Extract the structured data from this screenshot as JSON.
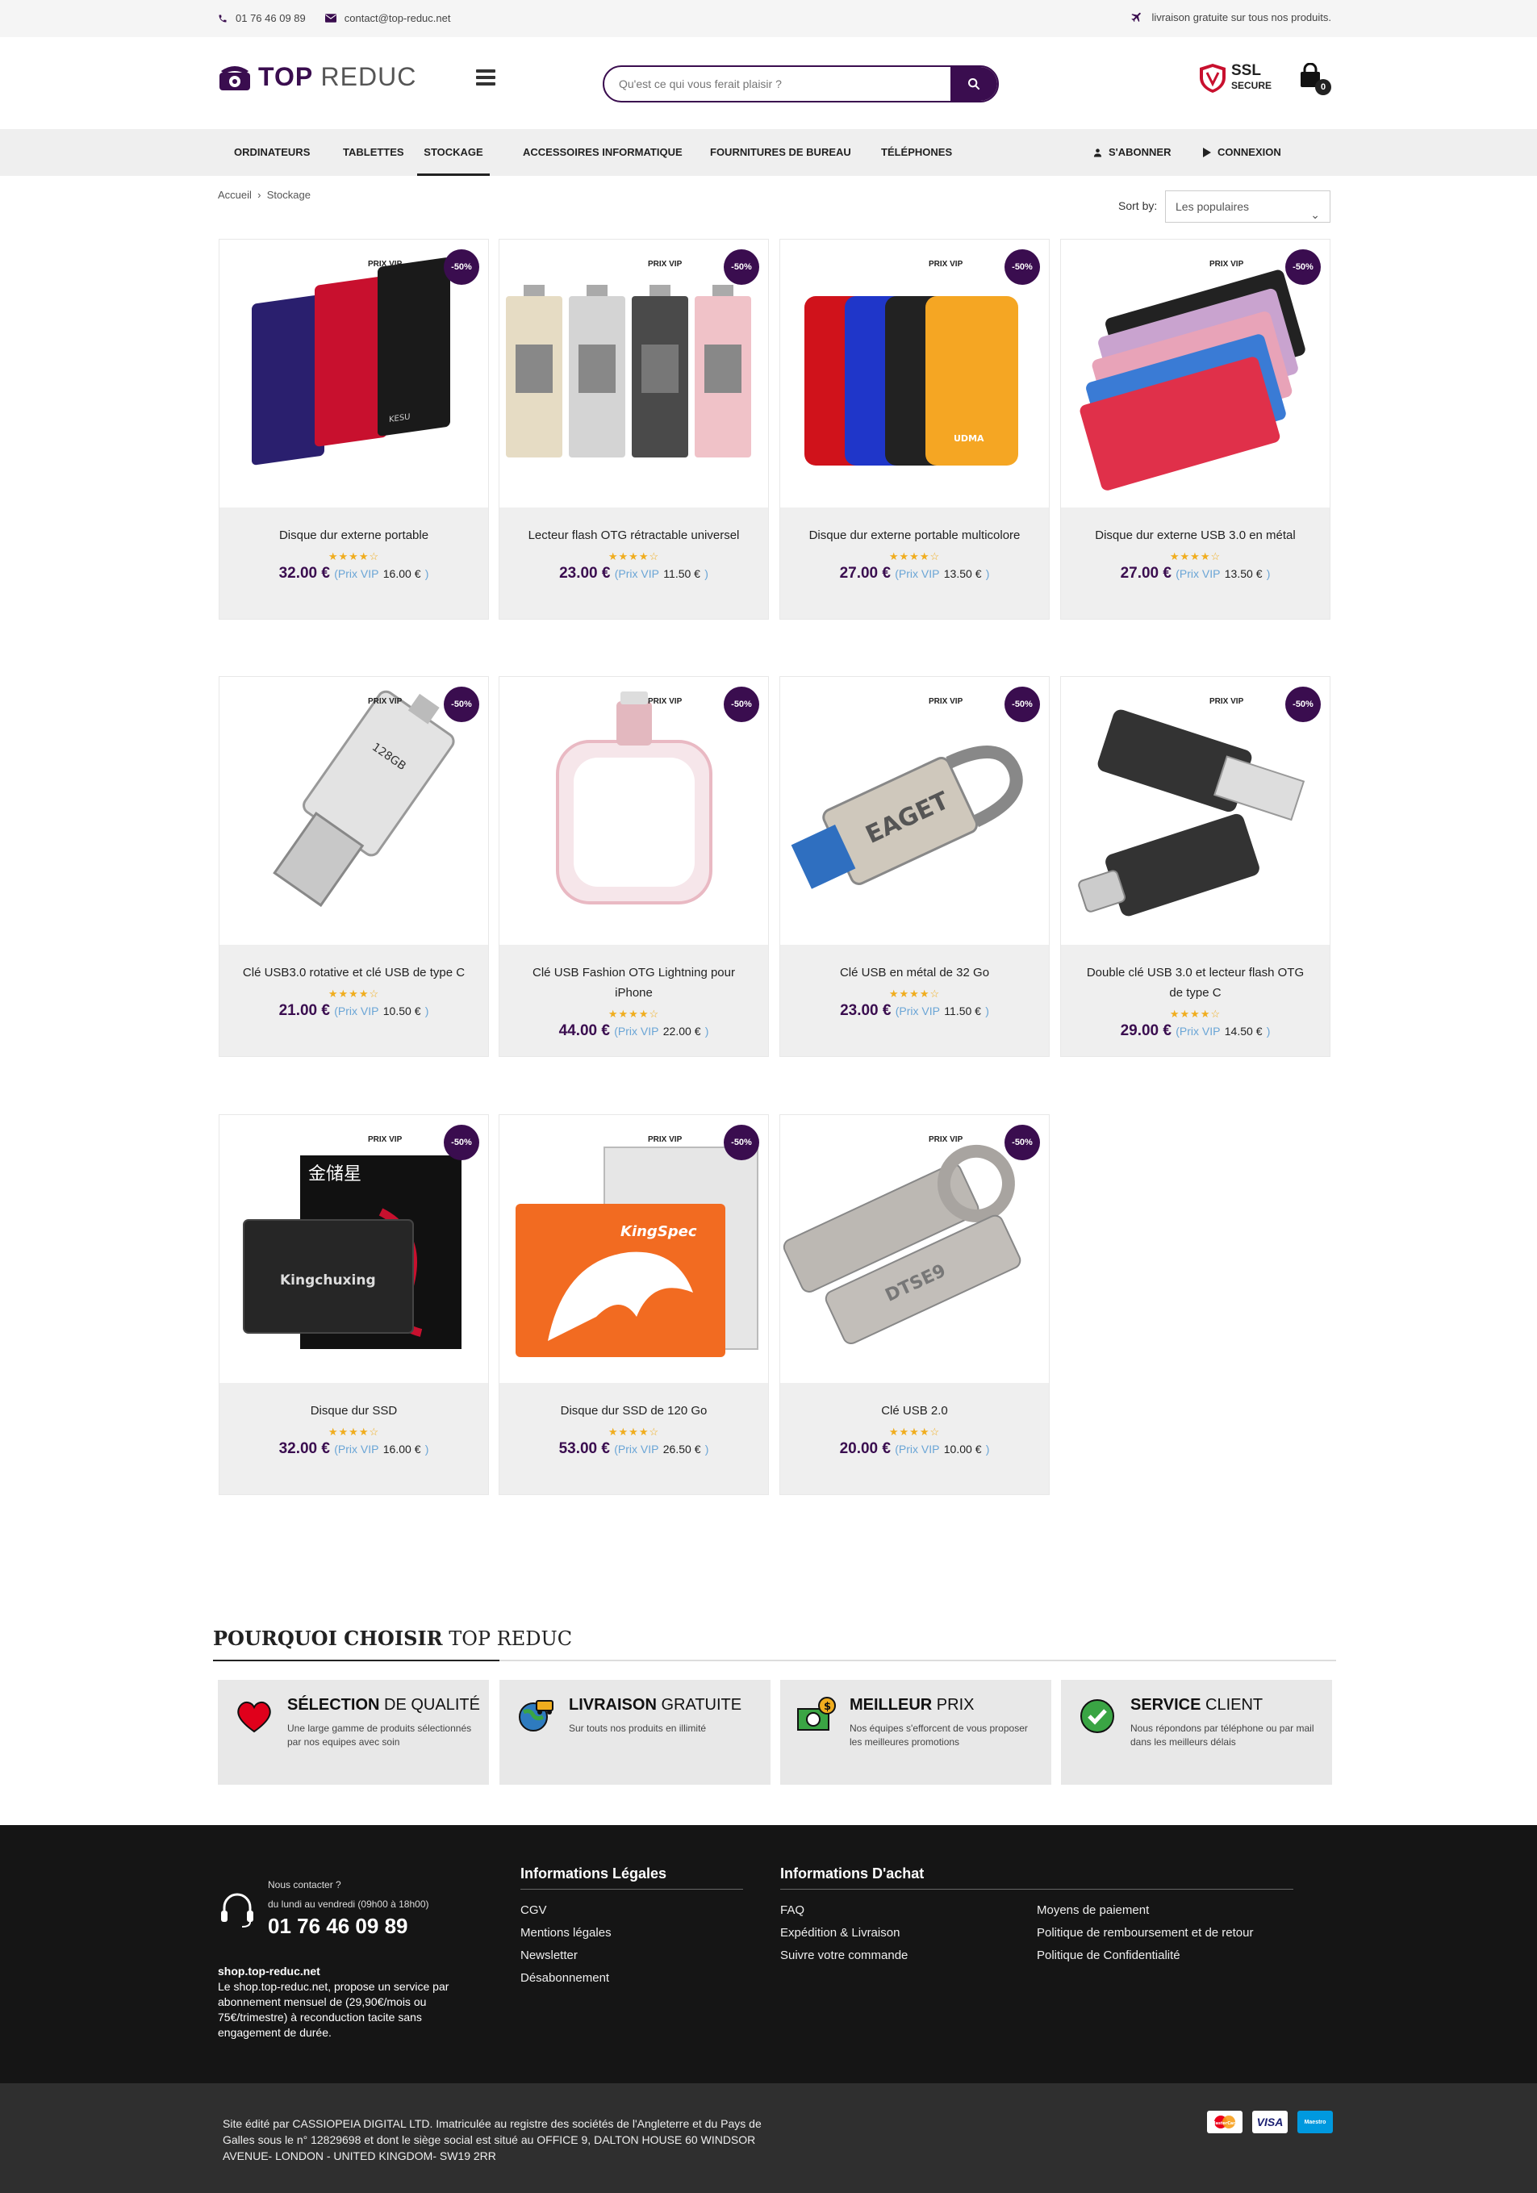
{
  "topbar": {
    "phone": "01 76 46 09 89",
    "email": "contact@top-reduc.net",
    "shipping": "livraison gratuite sur tous nos produits."
  },
  "header": {
    "logo_main": "TOP",
    "logo_sub": "REDUC",
    "search_placeholder": "Qu'est ce qui vous ferait plaisir ?",
    "ssl_title": "SSL",
    "ssl_sub": "SECURE",
    "cart_count": "0"
  },
  "nav": {
    "items": [
      "ORDINATEURS",
      "TABLETTES",
      "STOCKAGE",
      "ACCESSOIRES INFORMATIQUE",
      "FOURNITURES DE BUREAU",
      "TÉLÉPHONES"
    ],
    "subscribe": "S'ABONNER",
    "login": "CONNEXION"
  },
  "breadcrumb": {
    "home": "Accueil",
    "sep": "›",
    "current": "Stockage"
  },
  "sort": {
    "label": "Sort by:",
    "value": "Les populaires"
  },
  "products": [
    {
      "name": "Disque dur externe portable",
      "price": "32.00 €",
      "vip": "16.00 €",
      "rating": 4
    },
    {
      "name": "Lecteur flash OTG rétractable universel",
      "price": "23.00 €",
      "vip": "11.50 €",
      "rating": 4
    },
    {
      "name": "Disque dur externe portable multicolore",
      "price": "27.00 €",
      "vip": "13.50 €",
      "rating": 4
    },
    {
      "name": "Disque dur externe USB 3.0 en métal",
      "price": "27.00 €",
      "vip": "13.50 €",
      "rating": 4
    },
    {
      "name": "Clé USB3.0 rotative et clé USB de type C",
      "price": "21.00 €",
      "vip": "10.50 €",
      "rating": 4
    },
    {
      "name": "Clé USB Fashion OTG Lightning pour iPhone",
      "price": "44.00 €",
      "vip": "22.00 €",
      "rating": 4
    },
    {
      "name": "Clé USB en métal de 32 Go",
      "price": "23.00 €",
      "vip": "11.50 €",
      "rating": 4
    },
    {
      "name": "Double clé USB 3.0 et lecteur flash OTG de type C",
      "price": "29.00 €",
      "vip": "14.50 €",
      "rating": 4
    },
    {
      "name": "Disque dur SSD",
      "price": "32.00 €",
      "vip": "16.00 €",
      "rating": 4
    },
    {
      "name": "Disque dur SSD de 120 Go",
      "price": "53.00 €",
      "vip": "26.50 €",
      "rating": 4
    },
    {
      "name": "Clé USB 2.0",
      "price": "20.00 €",
      "vip": "10.00 €",
      "rating": 4
    }
  ],
  "labels": {
    "prix_vip_badge": "PRIX VIP",
    "discount": "-50%",
    "prix_vip_open": "(Prix VIP",
    "close": ")"
  },
  "why": {
    "title_bold": "POURQUOI CHOISIR",
    "title_rest": "TOP REDUC",
    "items": [
      {
        "bold": "SÉLECTION",
        "rest": "DE QUALITÉ",
        "desc": "Une large gamme de produits sélectionnés par nos equipes avec soin"
      },
      {
        "bold": "LIVRAISON",
        "rest": "GRATUITE",
        "desc": "Sur touts nos produits en illimité"
      },
      {
        "bold": "MEILLEUR",
        "rest": "PRIX",
        "desc": "Nos équipes s'efforcent de vous proposer les meilleures promotions"
      },
      {
        "bold": "SERVICE",
        "rest": "CLIENT",
        "desc": "Nous répondons par téléphone ou par mail dans les meilleurs délais"
      }
    ]
  },
  "footer": {
    "contact_title": "Nous contacter ?",
    "hours": "du lundi au vendredi (09h00 à 18h00)",
    "phone": "01 76 46 09 89",
    "site": "shop.top-reduc.net",
    "about": "Le shop.top-reduc.net, propose un service par abonnement mensuel de (29,90€/mois ou 75€/trimestre) à reconduction tacite sans engagement de durée.",
    "legal_title": "Informations Légales",
    "legal_links": [
      "CGV",
      "Mentions légales",
      "Newsletter",
      "Désabonnement"
    ],
    "buy_title": "Informations D'achat",
    "buy_links_1": [
      "FAQ",
      "Expédition & Livraison",
      "Suivre votre commande"
    ],
    "buy_links_2": [
      "Moyens de paiement",
      "Politique de remboursement et de retour",
      "Politique de Confidentialité"
    ],
    "copyright": "Site édité par CASSIOPEIA DIGITAL LTD. Imatriculée au registre des sociétés de l'Angleterre et du Pays de Galles sous le n° 12829698 et dont le siège social est situé au OFFICE 9, DALTON HOUSE 60 WINDSOR AVENUE- LONDON - UNITED KINGDOM- SW19 2RR",
    "payment": [
      "MasterCard",
      "VISA",
      "Maestro"
    ]
  },
  "colors": {
    "brand": "#3a0d4f",
    "star": "#f0ad1e",
    "vip": "#6aa5d6"
  }
}
